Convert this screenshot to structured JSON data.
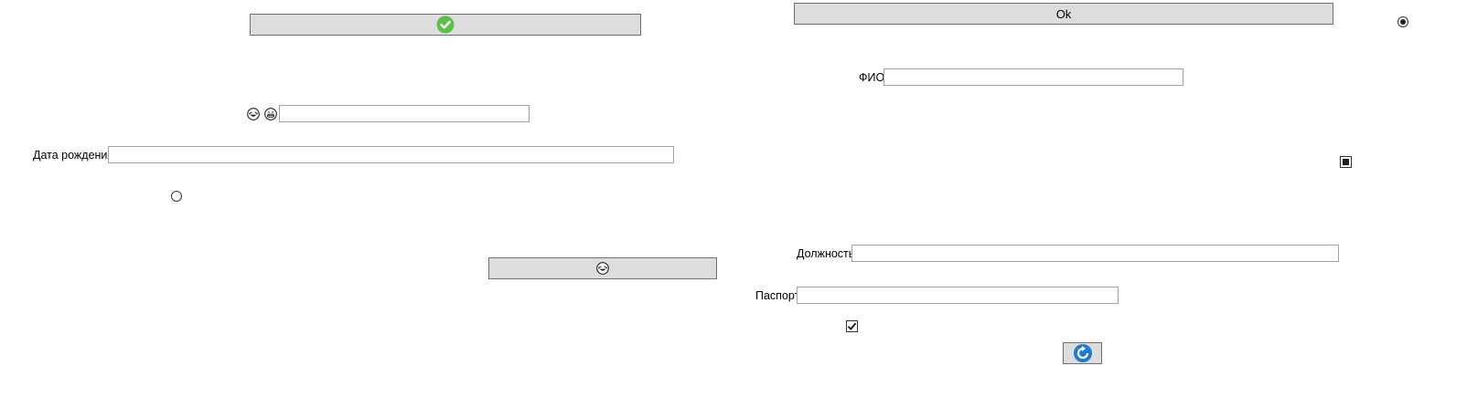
{
  "left": {
    "check_button": {
      "icon": "green-check-circle-icon",
      "icon_color": "#5cbf4a"
    },
    "emoji_icons": [
      "laughing-face-icon",
      "grinning-face-icon"
    ],
    "emoji_field": {
      "value": "",
      "placeholder": ""
    },
    "birth_date": {
      "label": "Дата рождения",
      "value": ""
    },
    "radio_unchecked": {
      "checked": false
    },
    "emoji_button": {
      "icon": "laughing-face-icon"
    }
  },
  "right": {
    "ok_button": {
      "label": "Ok"
    },
    "radio_checked": {
      "checked": true
    },
    "fio": {
      "label": "ФИО",
      "value": ""
    },
    "indeterminate_checkbox": {
      "state": "indeterminate"
    },
    "position": {
      "label": "Должность",
      "value": ""
    },
    "passport": {
      "label": "Паспорт",
      "value": ""
    },
    "checkbox_checked": {
      "checked": true
    },
    "refresh_button": {
      "icon": "refresh-arrow-icon",
      "icon_color": "#1f7bd1"
    }
  }
}
